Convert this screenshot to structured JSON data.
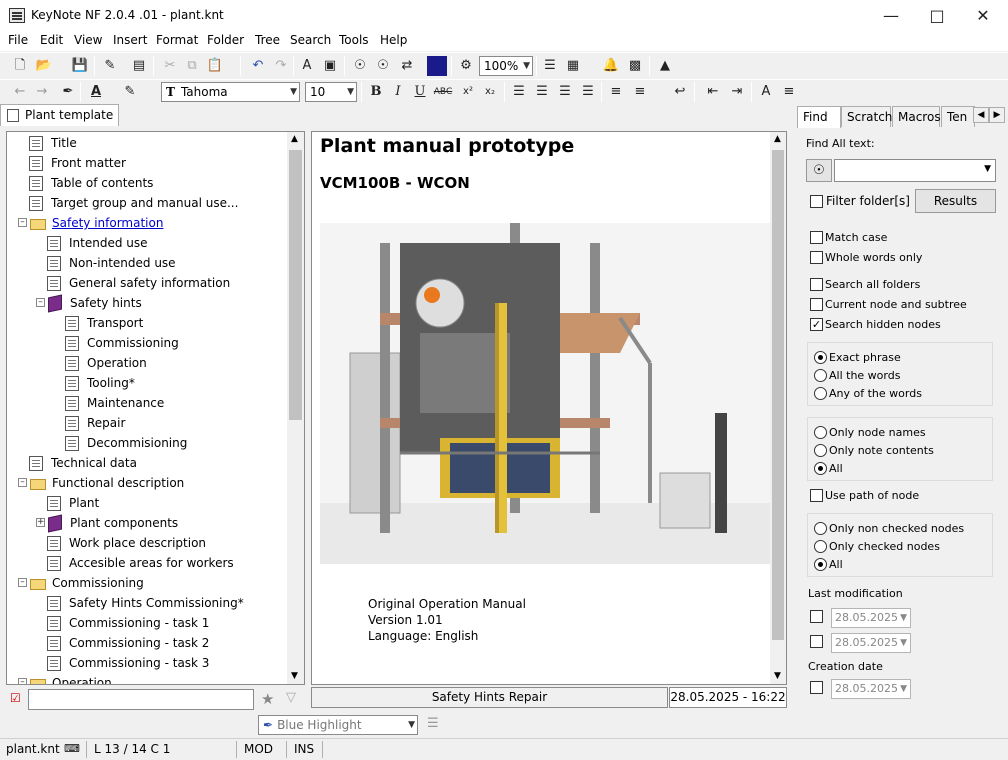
{
  "window": {
    "title": "KeyNote NF  2.0.4 .01 - plant.knt"
  },
  "menu": [
    "File",
    "Edit",
    "View",
    "Insert",
    "Format",
    "Folder",
    "Tree",
    "Search",
    "Tools",
    "Help"
  ],
  "toolbar": {
    "zoom": "100%",
    "font": "Tahoma",
    "font_size": "10",
    "highlight": "Blue Highlight"
  },
  "left_tab": {
    "label": "Plant template"
  },
  "tree": [
    {
      "label": "Title"
    },
    {
      "label": "Front matter"
    },
    {
      "label": "Table of contents"
    },
    {
      "label": "Target group and manual use..."
    },
    {
      "label": "Safety information"
    },
    {
      "label": "Intended use"
    },
    {
      "label": "Non-intended use"
    },
    {
      "label": "General safety information"
    },
    {
      "label": "Safety hints"
    },
    {
      "label": "Transport"
    },
    {
      "label": "Commissioning"
    },
    {
      "label": "Operation"
    },
    {
      "label": "Tooling*"
    },
    {
      "label": "Maintenance"
    },
    {
      "label": "Repair"
    },
    {
      "label": "Decommisioning"
    },
    {
      "label": "Technical data"
    },
    {
      "label": "Functional description"
    },
    {
      "label": "Plant"
    },
    {
      "label": "Plant components"
    },
    {
      "label": "Work place description"
    },
    {
      "label": "Accesible areas for workers"
    },
    {
      "label": "Commissioning"
    },
    {
      "label": "Safety Hints Commissioning*"
    },
    {
      "label": "Commissioning - task 1"
    },
    {
      "label": "Commissioning - task 2"
    },
    {
      "label": "Commissioning - task 3"
    },
    {
      "label": "Operation"
    }
  ],
  "document": {
    "title": "Plant manual prototype",
    "subtitle": "VCM100B - WCON",
    "lines": [
      "Original Operation Manual",
      "Version 1.01",
      "Language: English"
    ]
  },
  "status": {
    "node": "Safety Hints Repair",
    "datetime": "28.05.2025 - 16:22"
  },
  "find_panel": {
    "tabs": [
      "Find",
      "Scratch",
      "Macros",
      "Ten"
    ],
    "find_label": "Find All text:",
    "filter_folders": "Filter folder[s]",
    "results_button": "Results",
    "options": [
      "Match case",
      "Whole words only",
      "Search all folders",
      "Current node and subtree",
      "Search hidden nodes"
    ],
    "phrase_modes": [
      "Exact phrase",
      "All the words",
      "Any of the words"
    ],
    "scope_modes": [
      "Only node names",
      "Only note contents",
      "All"
    ],
    "use_path": "Use path of node",
    "check_modes": [
      "Only non checked nodes",
      "Only checked nodes",
      "All"
    ],
    "last_modification": "Last modification",
    "creation_date": "Creation date",
    "date1": "28.05.2025",
    "date2": "28.05.2025",
    "date3": "28.05.2025"
  },
  "statusbar": {
    "file": "plant.knt",
    "position": "L 13 / 14  C 1",
    "mod": "MOD",
    "ins": "INS"
  }
}
